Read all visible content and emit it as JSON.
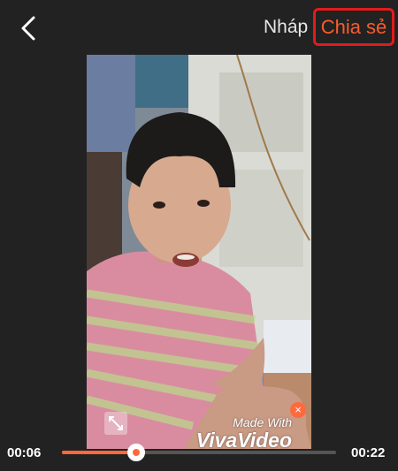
{
  "header": {
    "draft_label": "Nháp",
    "share_label": "Chia sẻ",
    "share_highlight_color": "#e21b1b",
    "share_text_color": "#ff5a2a"
  },
  "video": {
    "watermark_line1": "Made With",
    "watermark_line2": "VivaVideo",
    "close_glyph": "×"
  },
  "player": {
    "current_time": "00:06",
    "total_time": "00:22",
    "progress": 0.27,
    "accent_color": "#ff6a3d"
  },
  "icons": {
    "back": "chevron-left-icon",
    "expand": "expand-icon",
    "watermark_close": "close-icon"
  }
}
